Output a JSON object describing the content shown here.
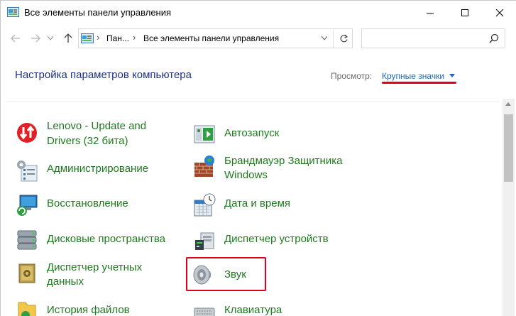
{
  "window": {
    "title": "Все элементы панели управления",
    "controls": {
      "minimize": "minimize",
      "maximize": "maximize",
      "close": "close"
    }
  },
  "address_bar": {
    "crumbs": [
      "Пан...",
      "Все элементы панели управления"
    ],
    "search_placeholder": ""
  },
  "header": {
    "title": "Настройка параметров компьютера",
    "view_label": "Просмотр:",
    "view_value": "Крупные значки"
  },
  "items": [
    {
      "label": "Lenovo - Update and",
      "label2": "Drivers (32 бита)",
      "icon": "lenovo-update-icon"
    },
    {
      "label": "Автозапуск",
      "icon": "autoplay-icon"
    },
    {
      "label": "Администрирование",
      "icon": "admin-tools-icon"
    },
    {
      "label": "Брандмауэр Защитника",
      "label2": "Windows",
      "icon": "firewall-icon"
    },
    {
      "label": "Восстановление",
      "icon": "recovery-icon"
    },
    {
      "label": "Дата и время",
      "icon": "date-time-icon"
    },
    {
      "label": "Дисковые пространства",
      "icon": "storage-spaces-icon"
    },
    {
      "label": "Диспетчер устройств",
      "icon": "device-manager-icon"
    },
    {
      "label": "Диспетчер учетных",
      "label2": "данных",
      "icon": "credential-manager-icon"
    },
    {
      "label": "Звук",
      "icon": "sound-icon"
    },
    {
      "label": "История файлов",
      "icon": "file-history-icon"
    },
    {
      "label": "Клавиатура",
      "icon": "keyboard-icon"
    }
  ],
  "colors": {
    "link_green": "#1f7a1f",
    "title_blue": "#1e3287",
    "accent_red": "#e0001b"
  }
}
